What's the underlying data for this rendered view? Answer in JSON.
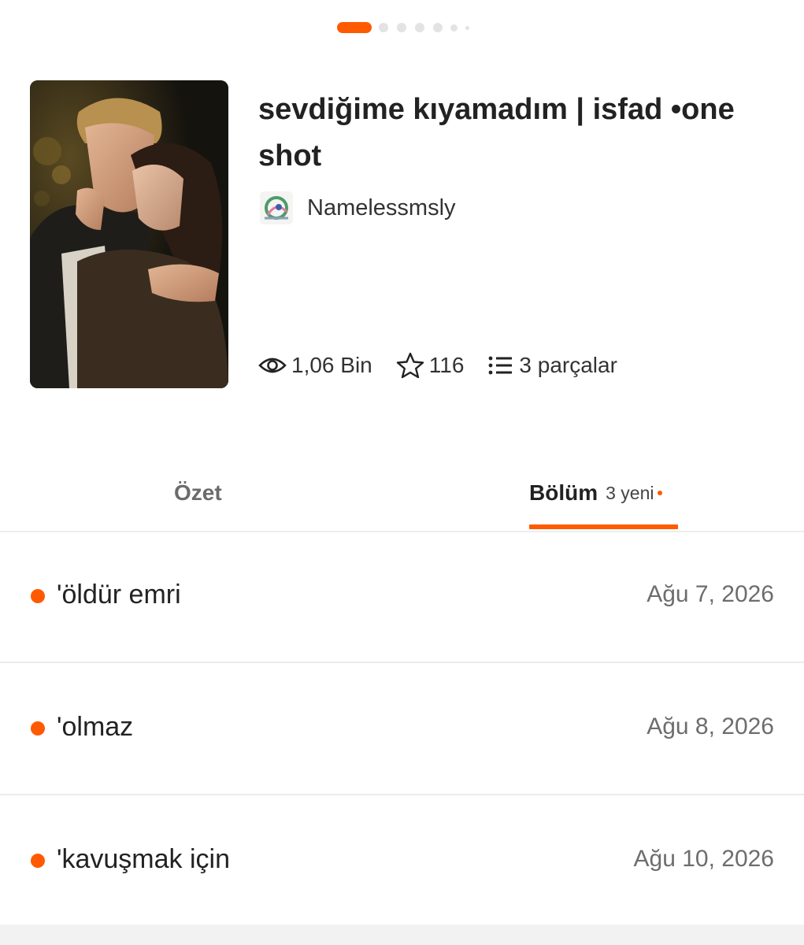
{
  "pager": {
    "active_index": 0,
    "total": 7
  },
  "story": {
    "title": "sevdiğime kıyamadım | isfad •one shot",
    "author": "Namelessmsly",
    "stats": {
      "reads": "1,06 Bin",
      "votes": "116",
      "parts": "3 parçalar"
    }
  },
  "tabs": {
    "summary_label": "Özet",
    "parts_label": "Bölüm",
    "parts_new_count": "3 yeni"
  },
  "parts": [
    {
      "title": "'öldür emri",
      "date": "Ağu 7, 2026"
    },
    {
      "title": "'olmaz",
      "date": "Ağu 8, 2026"
    },
    {
      "title": "'kavuşmak için",
      "date": "Ağu 10, 2026"
    }
  ],
  "colors": {
    "accent": "#ff5a00",
    "text_primary": "#222222",
    "text_secondary": "#6d6d6d",
    "divider": "#ececec"
  },
  "icons": {
    "reads": "eye-icon",
    "votes": "star-icon",
    "parts": "list-icon"
  }
}
